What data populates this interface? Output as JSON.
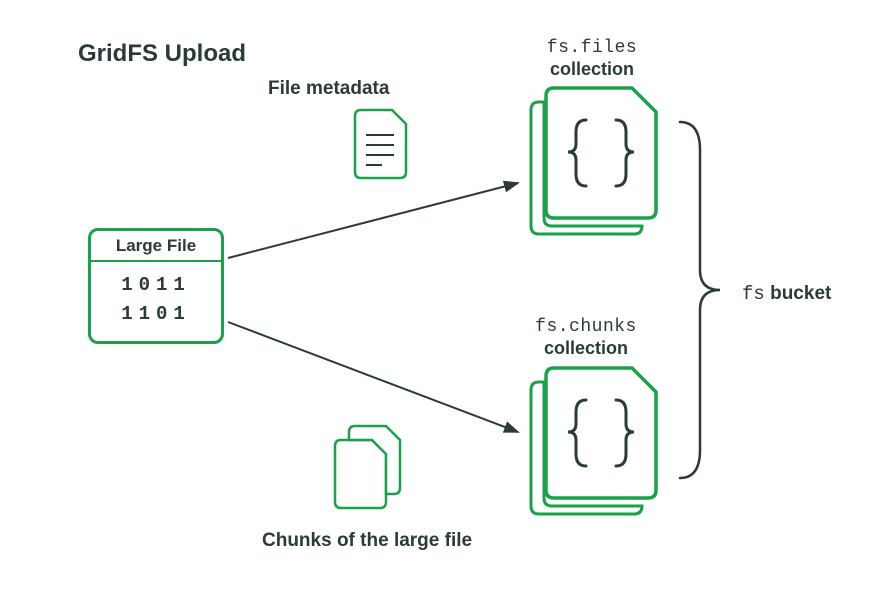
{
  "title": "GridFS Upload",
  "metadata_label": "File metadata",
  "chunks_label": "Chunks of the large file",
  "bucket_prefix": "fs",
  "bucket_word": "bucket",
  "files_collection_name": "fs.files",
  "chunks_collection_name": "fs.chunks",
  "collection_word": "collection",
  "large_file_label": "Large File",
  "bits_line1": "1011",
  "bits_line2": "1101",
  "colors": {
    "green": "#1aa24a",
    "dark": "#2b3b3b"
  }
}
